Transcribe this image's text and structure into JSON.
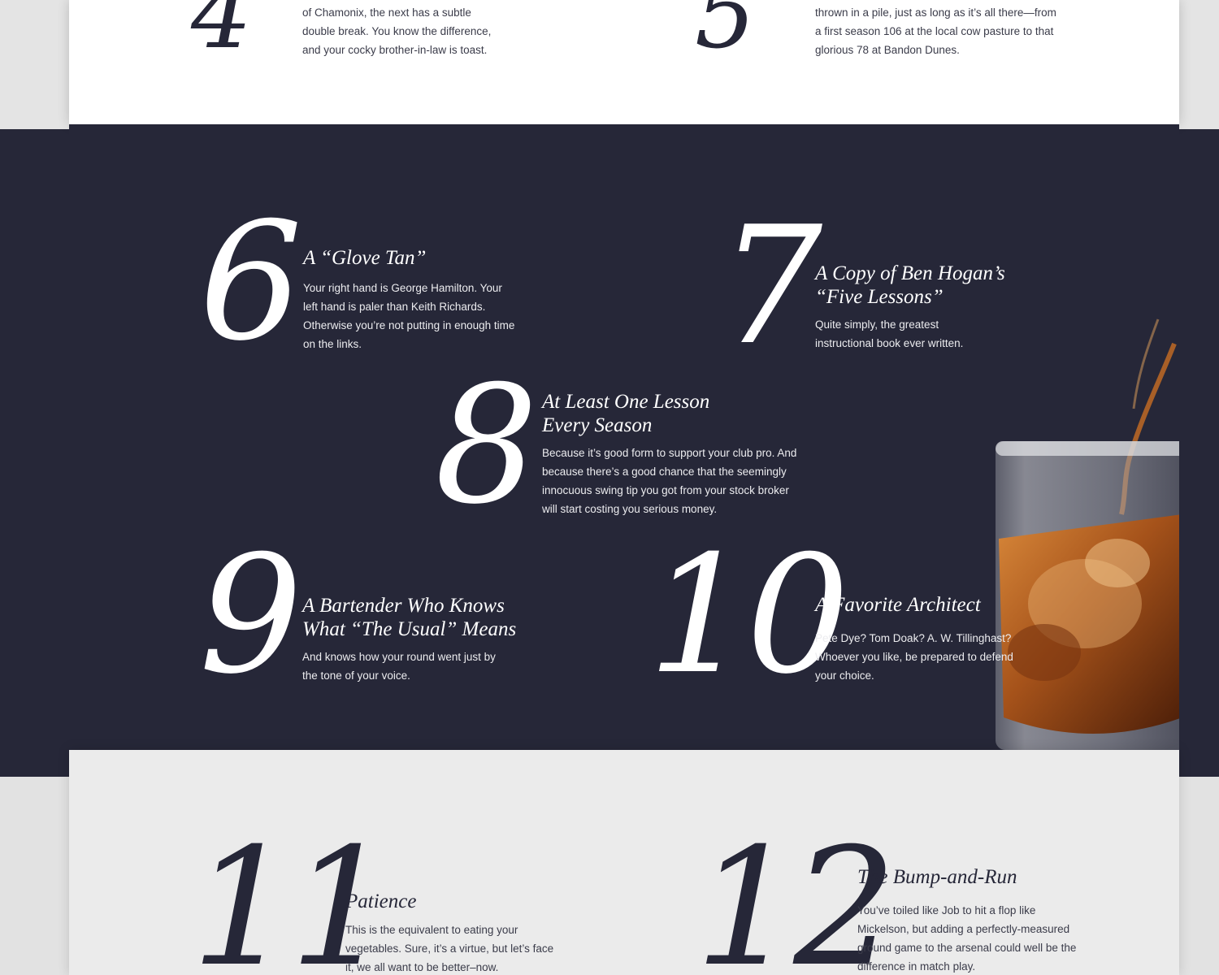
{
  "items": [
    {
      "num": "4",
      "title": "",
      "body": "of Chamonix, the next has a subtle double break. You know the difference, and your cocky brother-in-law is toast."
    },
    {
      "num": "5",
      "title": "",
      "body": "thrown in a pile, just as long as it’s all there—from a first season 106 at the local cow pasture to that glorious 78 at Bandon Dunes."
    },
    {
      "num": "6",
      "title": "A “Glove Tan”",
      "body": "Your right hand is George Hamilton. Your left hand is paler than Keith Richards. Otherwise you’re not putting in enough time on the links."
    },
    {
      "num": "7",
      "title": "A Copy of Ben Hogan’s\n“Five Lessons”",
      "body": "Quite simply, the greatest instructional book ever written."
    },
    {
      "num": "8",
      "title": "At Least One Lesson\nEvery Season",
      "body": "Because it’s good form to support your club pro. And because there’s a good chance that the seemingly innocuous swing tip you got from your stock broker will start costing you serious money."
    },
    {
      "num": "9",
      "title": "A Bartender Who Knows\nWhat “The Usual” Means",
      "body": "And knows how your round went just by the tone of your voice."
    },
    {
      "num": "10",
      "title": "A Favorite Architect",
      "body": "Pete Dye? Tom Doak? A. W. Tillinghast? Whoever you like, be prepared to defend your choice."
    },
    {
      "num": "11",
      "title": "Patience",
      "body": "This is the equivalent to eating your vegetables. Sure, it’s a virtue, but let’s face it, we all want to be better–now."
    },
    {
      "num": "12",
      "title": "The Bump-and-Run",
      "body": "You’ve toiled like Job to hit a flop like Mickelson, but adding a perfectly-measured ground game to the arsenal could well be the difference in match play."
    }
  ],
  "colors": {
    "navy": "#262738",
    "white": "#ffffff",
    "light_gray": "#ebebeb",
    "whiskey": "#a5521a"
  }
}
